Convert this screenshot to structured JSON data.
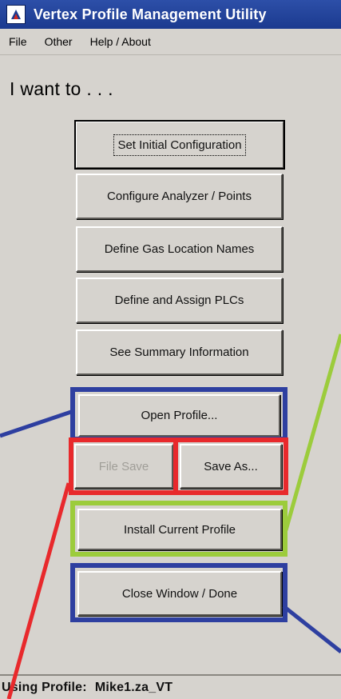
{
  "window": {
    "title": "Vertex Profile Management Utility",
    "icon": "vertex-logo-icon"
  },
  "menu": [
    "File",
    "Other",
    "Help / About"
  ],
  "heading": "I want to . . .",
  "buttons": {
    "set_initial": "Set Initial Configuration",
    "configure_analyzer": "Configure Analyzer / Points",
    "define_gas": "Define Gas Location Names",
    "define_plcs": "Define and Assign PLCs",
    "see_summary": "See Summary Information",
    "open_profile": "Open Profile...",
    "file_save": "File Save",
    "save_as": "Save As...",
    "install_profile": "Install Current Profile",
    "close_window": "Close Window / Done"
  },
  "status": {
    "label": "Using Profile:",
    "profile": "Mike1.za_VT"
  },
  "colors": {
    "blue": "#2e3fa0",
    "red": "#e8292c",
    "green": "#9ccc3c"
  }
}
